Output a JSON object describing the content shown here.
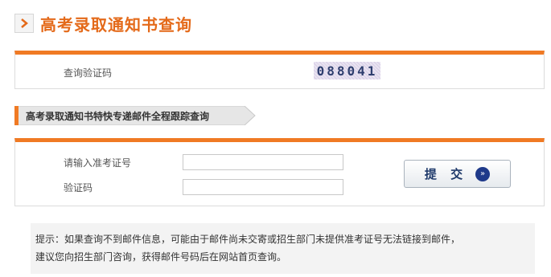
{
  "header": {
    "title": "高考录取通知书查询",
    "arrow_icon": "chevron-right-icon"
  },
  "captcha_section": {
    "label": "查询验证码",
    "code": "088041"
  },
  "tracking": {
    "title": "高考录取通知书特快专递邮件全程跟踪查询",
    "exam_number_label": "请输入准考证号",
    "exam_number_value": "",
    "verify_code_label": "验证码",
    "verify_code_value": "",
    "submit_label": "提 交",
    "submit_icon": "double-chevron-right-icon"
  },
  "tip": {
    "line1": "提示：如果查询不到邮件信息，可能由于邮件尚未交寄或招生部门未提供准考证号无法链接到邮件，",
    "line2": "建议您向招生部门咨询，获得邮件号码后在网站首页查询。"
  },
  "colors": {
    "accent": "#f07a24",
    "title": "#e46a1a",
    "button_text": "#1f3a6b"
  }
}
